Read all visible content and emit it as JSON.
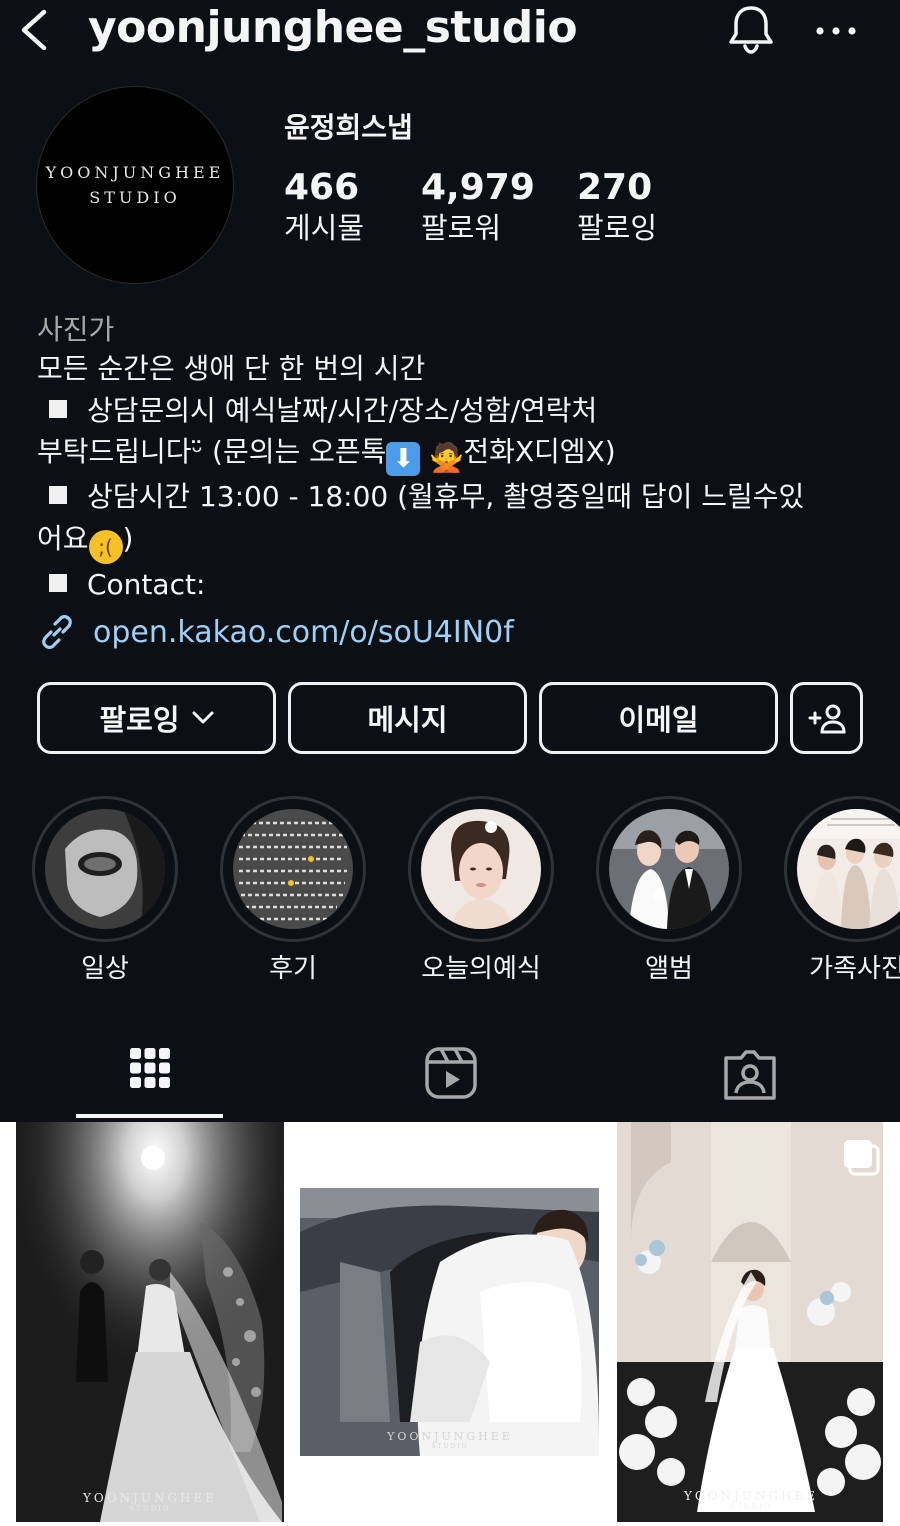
{
  "header": {
    "username": "yoonjunghee_studio",
    "back_icon": "chevron-left-icon",
    "bell_icon": "bell-icon",
    "more_icon": "more-horizontal-icon"
  },
  "profile": {
    "avatar_lines": [
      "YOONJUNGHEE",
      "STUDIO"
    ],
    "display_name": "윤정희스냅",
    "stats": [
      {
        "value": "466",
        "label": "게시물"
      },
      {
        "value": "4,979",
        "label": "팔로워"
      },
      {
        "value": "270",
        "label": "팔로잉"
      }
    ]
  },
  "bio": {
    "category": "사진가",
    "line1": "모든 순간은 생애 단 한 번의 시간",
    "line2": "상담문의시 예식날짜/시간/장소/성함/연락처",
    "line3a": "부탁드립니다ᵕ̈ (문의는 오픈톡",
    "line3b": "전화X디엠X)",
    "line4": "상담시간 13:00 - 18:00 (월휴무, 촬영중일때 답이 느릴수있",
    "line5": "어요",
    "line5_end": ")",
    "line6": "Contact:",
    "link": "open.kakao.com/o/soU4IN0f"
  },
  "buttons": {
    "following": "팔로잉",
    "message": "메시지",
    "email": "이메일",
    "add_person_icon": "add-person-icon"
  },
  "highlights": [
    {
      "label": "일상"
    },
    {
      "label": "후기"
    },
    {
      "label": "오늘의예식"
    },
    {
      "label": "앨범"
    },
    {
      "label": "가족사진"
    }
  ],
  "tabs": [
    {
      "name": "posts",
      "icon": "grid-icon",
      "active": true
    },
    {
      "name": "reels",
      "icon": "reels-icon",
      "active": false
    },
    {
      "name": "tagged",
      "icon": "tagged-person-icon",
      "active": false
    }
  ],
  "posts": [
    {
      "watermark": [
        "YOONJUNGHEE",
        "STUDIO"
      ]
    },
    {
      "watermark": [
        "YOONJUNGHEE",
        "STUDIO"
      ]
    },
    {
      "watermark": [
        "YOONJUNGHEE",
        "STUDIO"
      ],
      "multi_icon": "carousel-icon"
    }
  ],
  "colors": {
    "background": "#0c1014",
    "link": "#9ed0f7",
    "text": "#f5f5f5",
    "muted": "#a8a8a8"
  }
}
